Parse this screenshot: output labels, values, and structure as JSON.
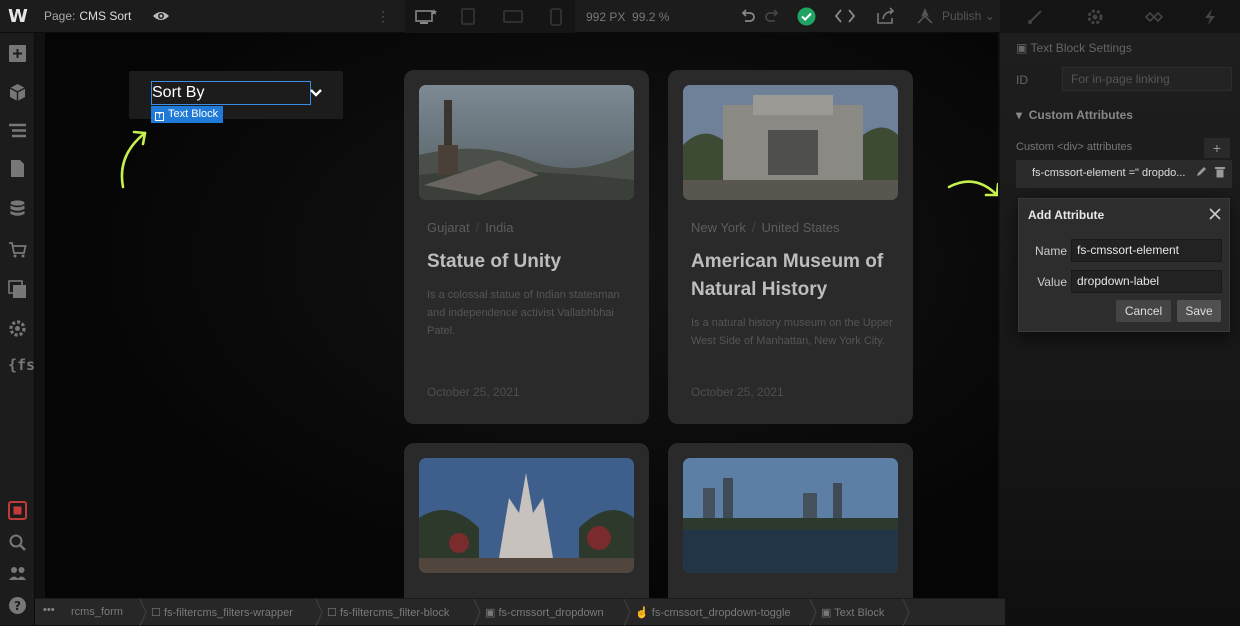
{
  "topbar": {
    "logo": "W",
    "page_prefix": "Page:",
    "page_name": "CMS Sort",
    "dimensions": "992 PX",
    "zoom": "99.2 %",
    "publish_label": "Publish"
  },
  "canvas": {
    "dropdown_label": "Sort By",
    "selected_badge": "Text Block",
    "cards": [
      {
        "region": "Gujarat",
        "country": "India",
        "title": "Statue of Unity",
        "description": "Is a colossal statue of Indian statesman and independence activist Vallabhbhai Patel.",
        "date": "October 25, 2021"
      },
      {
        "region": "New York",
        "country": "United States",
        "title": "American Museum of Natural History",
        "description": "Is a natural history museum on the Upper West Side of Manhattan, New York City.",
        "date": "October 25, 2021"
      }
    ]
  },
  "settings": {
    "header": "Text Block Settings",
    "id_label": "ID",
    "id_placeholder": "For in-page linking",
    "section_title": "Custom Attributes",
    "custom_label": "Custom <div> attributes",
    "existing_attribute": "fs-cmssort-element =\" dropdo..."
  },
  "modal": {
    "title": "Add Attribute",
    "name_label": "Name",
    "name_value": "fs-cmssort-element",
    "value_label": "Value",
    "value_value": "dropdown-label",
    "cancel_label": "Cancel",
    "save_label": "Save"
  },
  "breadcrumb": [
    "rcms_form",
    "fs-filtercms_filters-wrapper",
    "fs-filtercms_filter-block",
    "fs-cmssort_dropdown",
    "fs-cmssort_dropdown-toggle",
    "Text Block"
  ],
  "colors": {
    "accent_blue": "#1f7ad8",
    "arrow_green": "#c6f04d",
    "success_green": "#1fa463"
  }
}
